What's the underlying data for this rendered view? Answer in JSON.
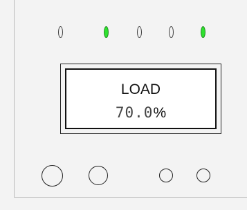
{
  "panel": {
    "leds": [
      {
        "name": "led-1",
        "state": "off"
      },
      {
        "name": "led-2",
        "state": "on"
      },
      {
        "name": "led-3",
        "state": "off"
      },
      {
        "name": "led-4",
        "state": "off"
      },
      {
        "name": "led-5",
        "state": "on"
      }
    ],
    "display": {
      "label": "LOAD",
      "value": "70.0",
      "unit": "%"
    },
    "knobs": [
      "knob-large-1",
      "knob-large-2",
      "knob-small-1",
      "knob-small-2"
    ],
    "colors": {
      "led_on": "#2ee12e",
      "led_off": "#f3f3f3",
      "background": "#f3f3f3"
    }
  }
}
